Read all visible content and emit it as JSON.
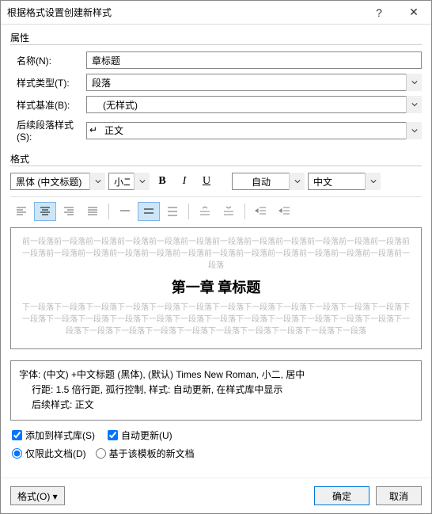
{
  "window": {
    "title": "根据格式设置创建新样式"
  },
  "sections": {
    "properties": "属性",
    "formatting": "格式"
  },
  "labels": {
    "name": "名称(N):",
    "styleType": "样式类型(T):",
    "basedOn": "样式基准(B):",
    "nextStyle": "后续段落样式(S):"
  },
  "fields": {
    "name": "章标题",
    "styleType": "段落",
    "basedOn": "(无样式)",
    "nextStyle": "正文"
  },
  "fontbar": {
    "font": "黑体 (中文标题)",
    "size": "小二",
    "color": "自动",
    "lang": "中文"
  },
  "preview": {
    "before": "前一段落前一段落前一段落前一段落前一段落前一段落前一段落前一段落前一段落前一段落前一段落前一段落前一段落前一段落前一段落前一段落前一段落前一段落前一段落前一段落前一段落前一段落前一段落前一段落前一段落",
    "title": "第一章 章标题",
    "after": "下一段落下一段落下一段落下一段落下一段落下一段落下一段落下一段落下一段落下一段落下一段落下一段落下一段落下一段落下一段落下一段落下一段落下一段落下一段落下一段落下一段落下一段落下一段落下一段落下一段落下一段落下一段落下一段落下一段落下一段落下一段落下一段落下一段落下一段落"
  },
  "description": {
    "line1": "字体: (中文) +中文标题 (黑体), (默认) Times New Roman, 小二, 居中",
    "line2": "行距: 1.5 倍行距, 孤行控制, 样式: 自动更新, 在样式库中显示",
    "line3": "后续样式: 正文"
  },
  "options": {
    "addToGallery": "添加到样式库(S)",
    "autoUpdate": "自动更新(U)",
    "onlyThisDoc": "仅限此文档(D)",
    "basedOnTemplate": "基于该模板的新文档"
  },
  "buttons": {
    "format": "格式(O) ▾",
    "ok": "确定",
    "cancel": "取消"
  }
}
